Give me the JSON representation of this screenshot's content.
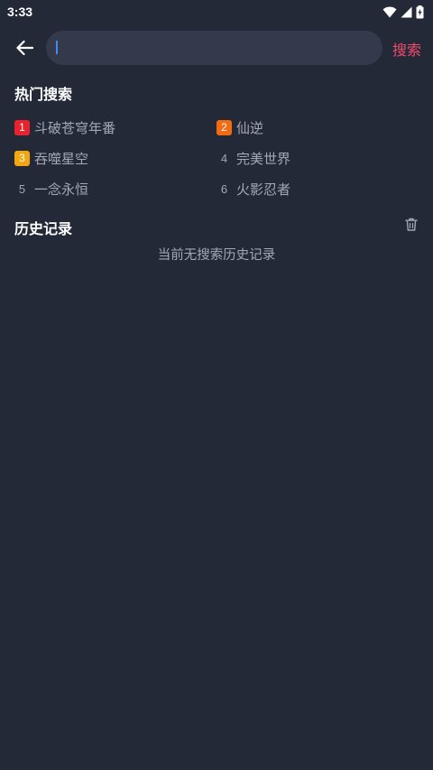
{
  "status_bar": {
    "time": "3:33"
  },
  "search": {
    "value": "",
    "placeholder": "",
    "submit_label": "搜索"
  },
  "hot": {
    "title": "热门搜索",
    "items": [
      {
        "rank": "1",
        "label": "斗破苍穹年番",
        "color": "#e8232e"
      },
      {
        "rank": "2",
        "label": "仙逆",
        "color": "#f26a12"
      },
      {
        "rank": "3",
        "label": "吞噬星空",
        "color": "#f2a60f"
      },
      {
        "rank": "4",
        "label": "完美世界"
      },
      {
        "rank": "5",
        "label": "一念永恒"
      },
      {
        "rank": "6",
        "label": "火影忍者"
      }
    ]
  },
  "history": {
    "title": "历史记录",
    "empty_text": "当前无搜索历史记录"
  },
  "colors": {
    "background": "#242938",
    "search_box": "#343a4b",
    "accent": "#f04b6a",
    "muted_text": "#a3a8b6"
  }
}
